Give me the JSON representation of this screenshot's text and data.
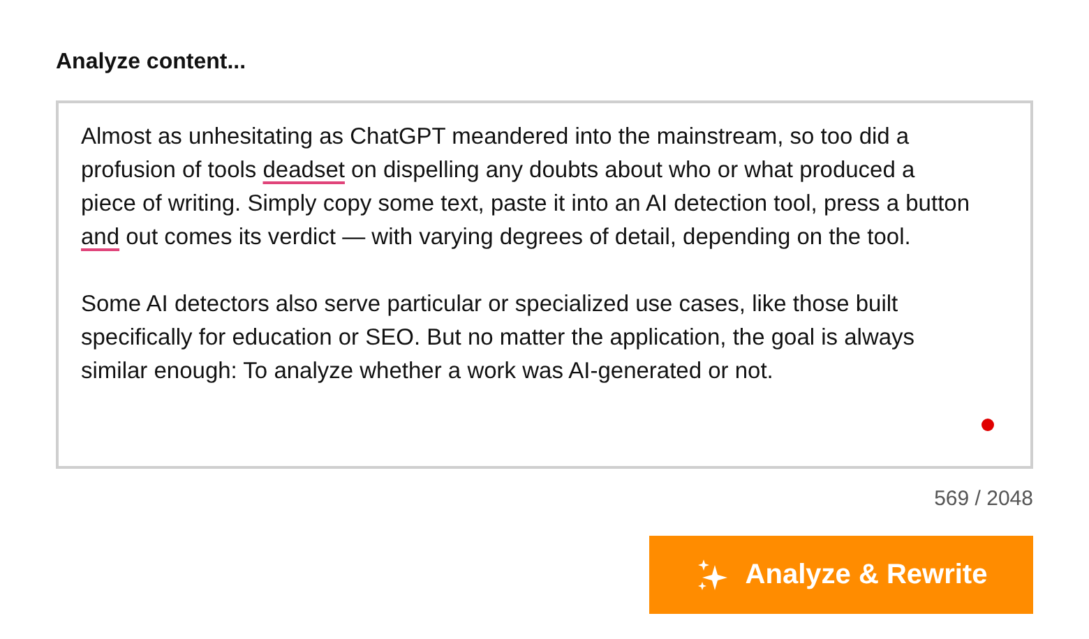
{
  "heading": "Analyze content...",
  "editor": {
    "paragraphs": [
      [
        {
          "text": "Almost as unhesitating as ChatGPT meandered into the mainstream, so too did a profusion of tools ",
          "flagged": false
        },
        {
          "text": "deadset",
          "flagged": true
        },
        {
          "text": " on dispelling any doubts about who or what produced a piece of writing. Simply copy some text, paste it into an AI detection tool, press a button ",
          "flagged": false
        },
        {
          "text": "and",
          "flagged": true
        },
        {
          "text": " out comes its verdict — with varying degrees of detail, depending on the tool.",
          "flagged": false
        }
      ],
      [
        {
          "text": "Some AI detectors also serve particular or specialized use cases, like those built specifically for education or SEO. But no matter the application, the goal is always similar enough: To analyze whether a work was AI-generated or not.",
          "flagged": false
        }
      ]
    ]
  },
  "counter": "569 / 2048",
  "button": {
    "label": "Analyze & Rewrite"
  }
}
